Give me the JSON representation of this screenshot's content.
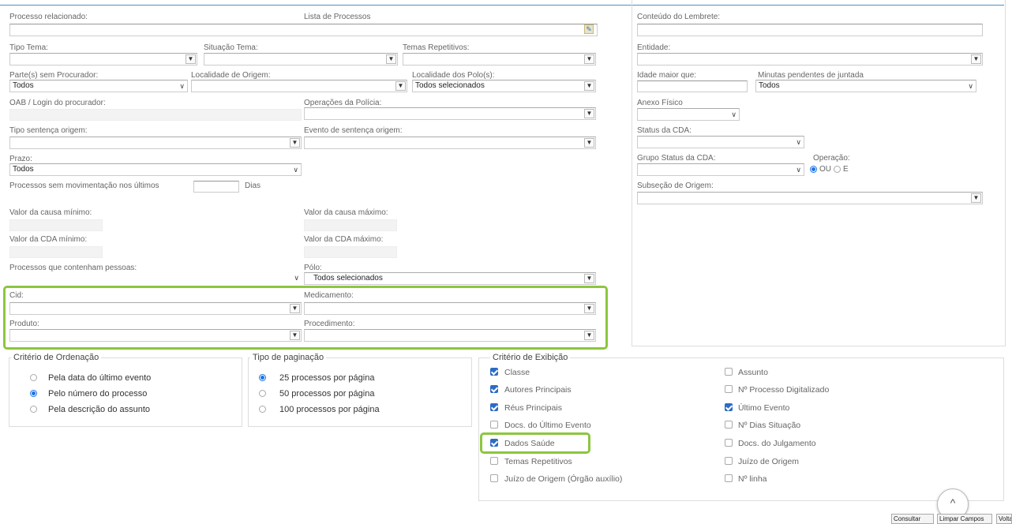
{
  "fields": {
    "processo_relacionado": "Processo relacionado:",
    "lista_processos": "Lista de Processos",
    "conteudo_lembrete": "Conteúdo do Lembrete:",
    "tipo_tema": "Tipo Tema:",
    "situacao_tema": "Situação Tema:",
    "temas_repetitivos": "Temas Repetitivos:",
    "entidade": "Entidade:",
    "partes_sem_procurador": "Parte(s) sem Procurador:",
    "partes_sem_procurador_value": "Todos",
    "localidade_origem": "Localidade de Origem:",
    "localidade_polos": "Localidade dos Polo(s):",
    "localidade_polos_value": "Todos selecionados",
    "idade_maior_que": "Idade maior que:",
    "minutas_pendentes": "Minutas pendentes de juntada",
    "minutas_pendentes_value": "Todos",
    "oab_login": "OAB / Login do procurador:",
    "operacoes_policia": "Operações da Polícia:",
    "anexo_fisico": "Anexo Físico",
    "tipo_sentenca_origem": "Tipo sentença origem:",
    "evento_sentenca_origem": "Evento de sentença origem:",
    "status_cda": "Status da CDA:",
    "prazo": "Prazo:",
    "prazo_value": "Todos",
    "grupo_status_cda": "Grupo Status da CDA:",
    "operacao": "Operação:",
    "operacao_ou": "OU",
    "operacao_e": "E",
    "processos_sem_mov": "Processos sem movimentação nos últimos",
    "dias": "Dias",
    "subsecao_origem": "Subseção de Origem:",
    "valor_causa_min": "Valor da causa mínimo:",
    "valor_causa_max": "Valor da causa máximo:",
    "valor_cda_min": "Valor da CDA mínimo:",
    "valor_cda_max": "Valor da CDA máximo:",
    "processos_pessoas": "Processos que contenham pessoas:",
    "polo": "Pólo:",
    "polo_value": "Todos selecionados",
    "cid": "Cid:",
    "medicamento": "Medicamento:",
    "produto": "Produto:",
    "procedimento": "Procedimento:"
  },
  "ordenacao": {
    "title": "Critério de Ordenação",
    "options": [
      "Pela data do último evento",
      "Pelo número do processo",
      "Pela descrição do assunto"
    ]
  },
  "paginacao": {
    "title": "Tipo de paginação",
    "options": [
      "25 processos por página",
      "50 processos por página",
      "100 processos por página"
    ]
  },
  "exibicao": {
    "title": "Critério de Exibição",
    "left": [
      {
        "label": "Classe",
        "checked": true
      },
      {
        "label": "Autores Principais",
        "checked": true
      },
      {
        "label": "Réus Principais",
        "checked": true
      },
      {
        "label": "Docs. do Último Evento",
        "checked": false
      },
      {
        "label": "Dados Saúde",
        "checked": true
      },
      {
        "label": "Temas Repetitivos",
        "checked": false
      },
      {
        "label": "Juízo de Origem (Órgão auxílio)",
        "checked": false
      }
    ],
    "right": [
      {
        "label": "Assunto",
        "checked": false
      },
      {
        "label": "Nº Processo Digitalizado",
        "checked": false
      },
      {
        "label": "Último Evento",
        "checked": true
      },
      {
        "label": "Nº Dias Situação",
        "checked": false
      },
      {
        "label": "Docs. do Julgamento",
        "checked": false
      },
      {
        "label": "Juízo de Origem",
        "checked": false
      },
      {
        "label": "Nº linha",
        "checked": false
      }
    ]
  },
  "buttons": {
    "consultar": "Consultar",
    "limpar": "Limpar Campos",
    "voltar": "Voltar"
  },
  "colors": {
    "highlight": "#8cc63f",
    "accent": "#1a73e8"
  }
}
